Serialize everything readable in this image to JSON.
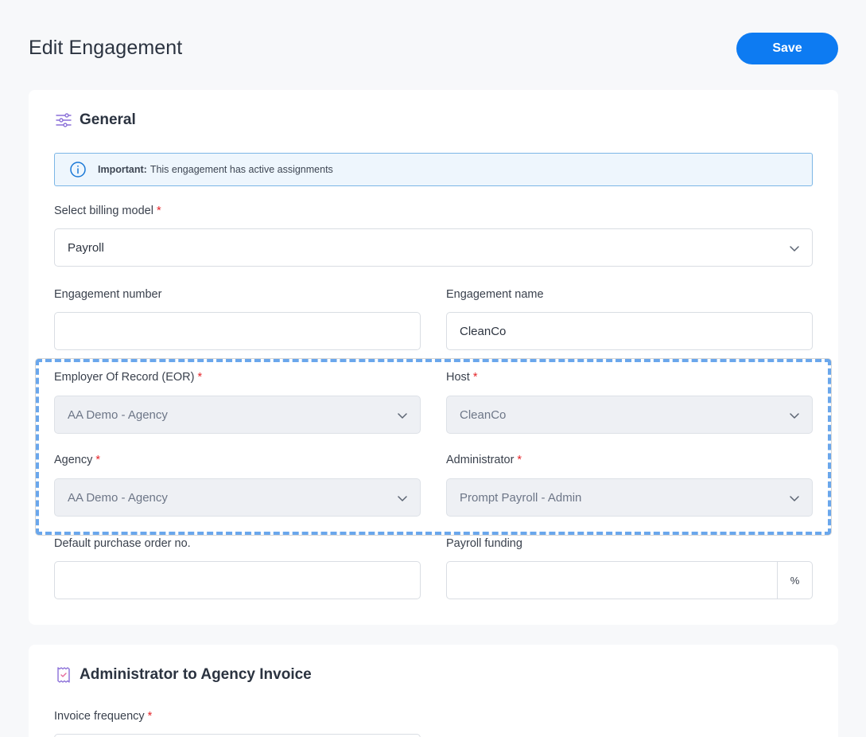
{
  "page": {
    "title": "Edit Engagement",
    "save_label": "Save"
  },
  "general": {
    "title": "General",
    "alert": {
      "strong": "Important:",
      "text": "This engagement has active assignments"
    },
    "billing_model": {
      "label": "Select billing model",
      "value": "Payroll"
    },
    "engagement_number": {
      "label": "Engagement number",
      "value": ""
    },
    "engagement_name": {
      "label": "Engagement name",
      "value": "CleanCo"
    },
    "eor": {
      "label": "Employer Of Record (EOR)",
      "value": "AA Demo - Agency"
    },
    "host": {
      "label": "Host",
      "value": "CleanCo"
    },
    "agency": {
      "label": "Agency",
      "value": "AA Demo - Agency"
    },
    "administrator": {
      "label": "Administrator",
      "value": "Prompt Payroll - Admin"
    },
    "purchase_order": {
      "label": "Default purchase order no.",
      "value": ""
    },
    "payroll_funding": {
      "label": "Payroll funding",
      "value": "",
      "suffix": "%"
    },
    "required_mark": "*"
  },
  "invoice": {
    "title": "Administrator to Agency Invoice",
    "frequency": {
      "label": "Invoice frequency"
    }
  },
  "colors": {
    "accent": "#0d7bf2",
    "required": "#e5252a",
    "highlight": "#6aa7ec"
  },
  "icons": {
    "general": "sliders-icon",
    "info": "info-circle-icon",
    "chevron": "chevron-down-icon",
    "invoice": "receipt-icon"
  }
}
